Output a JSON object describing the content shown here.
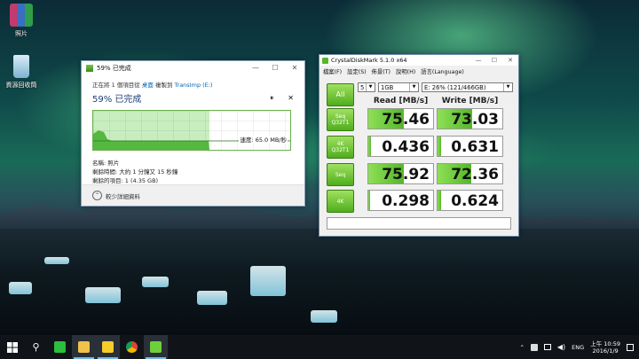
{
  "desktop": {
    "icons": [
      {
        "label": "照片",
        "color": "#c23a6e"
      },
      {
        "label": "資源回收筒",
        "color": "#9fc6de"
      }
    ]
  },
  "copy_dialog": {
    "title": "59% 已完成",
    "minimize": "—",
    "maximize": "☐",
    "close": "✕",
    "line_prefix": "正在將 1 個項目從",
    "line_source": "桌面",
    "line_mid": "複製到",
    "line_dest": "TransImp (E:)",
    "heading": "59% 已完成",
    "pause": "⏸",
    "cancel": "✕",
    "progress": 0.59,
    "speed": "速度: 65.0 MB/秒",
    "name_row": "名稱: 照片",
    "time_row": "剩餘時間: 大約 1 分鐘又 15 秒鐘",
    "items_row": "剩餘的項目: 1 (4.35 GB)",
    "details_toggle": "較少詳細資料",
    "details_icon": "⌃"
  },
  "cdm": {
    "title": "CrystalDiskMark 5.1.0 x64",
    "minimize": "—",
    "maximize": "☐",
    "close": "✕",
    "menu": [
      "檔案(F)",
      "設定(S)",
      "佈景(T)",
      "說明(H)",
      "語言(Language)"
    ],
    "all_label": "All",
    "count": "5",
    "size": "1GB",
    "drive": "E: 26% (121/466GB)",
    "dropdown_arrow": "▼",
    "read_header": "Read [MB/s]",
    "write_header": "Write [MB/s]",
    "rows": [
      {
        "label": "Seq\nQ32T1",
        "read": "75.46",
        "write": "73.03",
        "read_fill": 0.55,
        "write_fill": 0.53
      },
      {
        "label": "4K\nQ32T1",
        "read": "0.436",
        "write": "0.631",
        "read_fill": 0.04,
        "write_fill": 0.05
      },
      {
        "label": "Seq",
        "read": "75.92",
        "write": "72.36",
        "read_fill": 0.55,
        "write_fill": 0.52
      },
      {
        "label": "4K",
        "read": "0.298",
        "write": "0.624",
        "read_fill": 0.03,
        "write_fill": 0.05
      }
    ],
    "accent": "#55b62a"
  },
  "taskbar": {
    "start_icon": "windows-icon",
    "search_glyph": "⚲",
    "apps": [
      {
        "name": "line-icon",
        "color": "#2bbf3d",
        "active": false
      },
      {
        "name": "file-explorer-icon",
        "color": "#f2c14b",
        "active": true
      },
      {
        "name": "norton-icon",
        "color": "#f6cc2a",
        "active": true
      },
      {
        "name": "chrome-icon",
        "color": "#db4437",
        "active": false
      },
      {
        "name": "crystaldiskmark-icon",
        "color": "#6fcf3a",
        "active": true
      }
    ],
    "tray": {
      "expand": "⌃",
      "lang": "ENG",
      "time": "上午 10:59",
      "date": "2016/1/9"
    }
  }
}
